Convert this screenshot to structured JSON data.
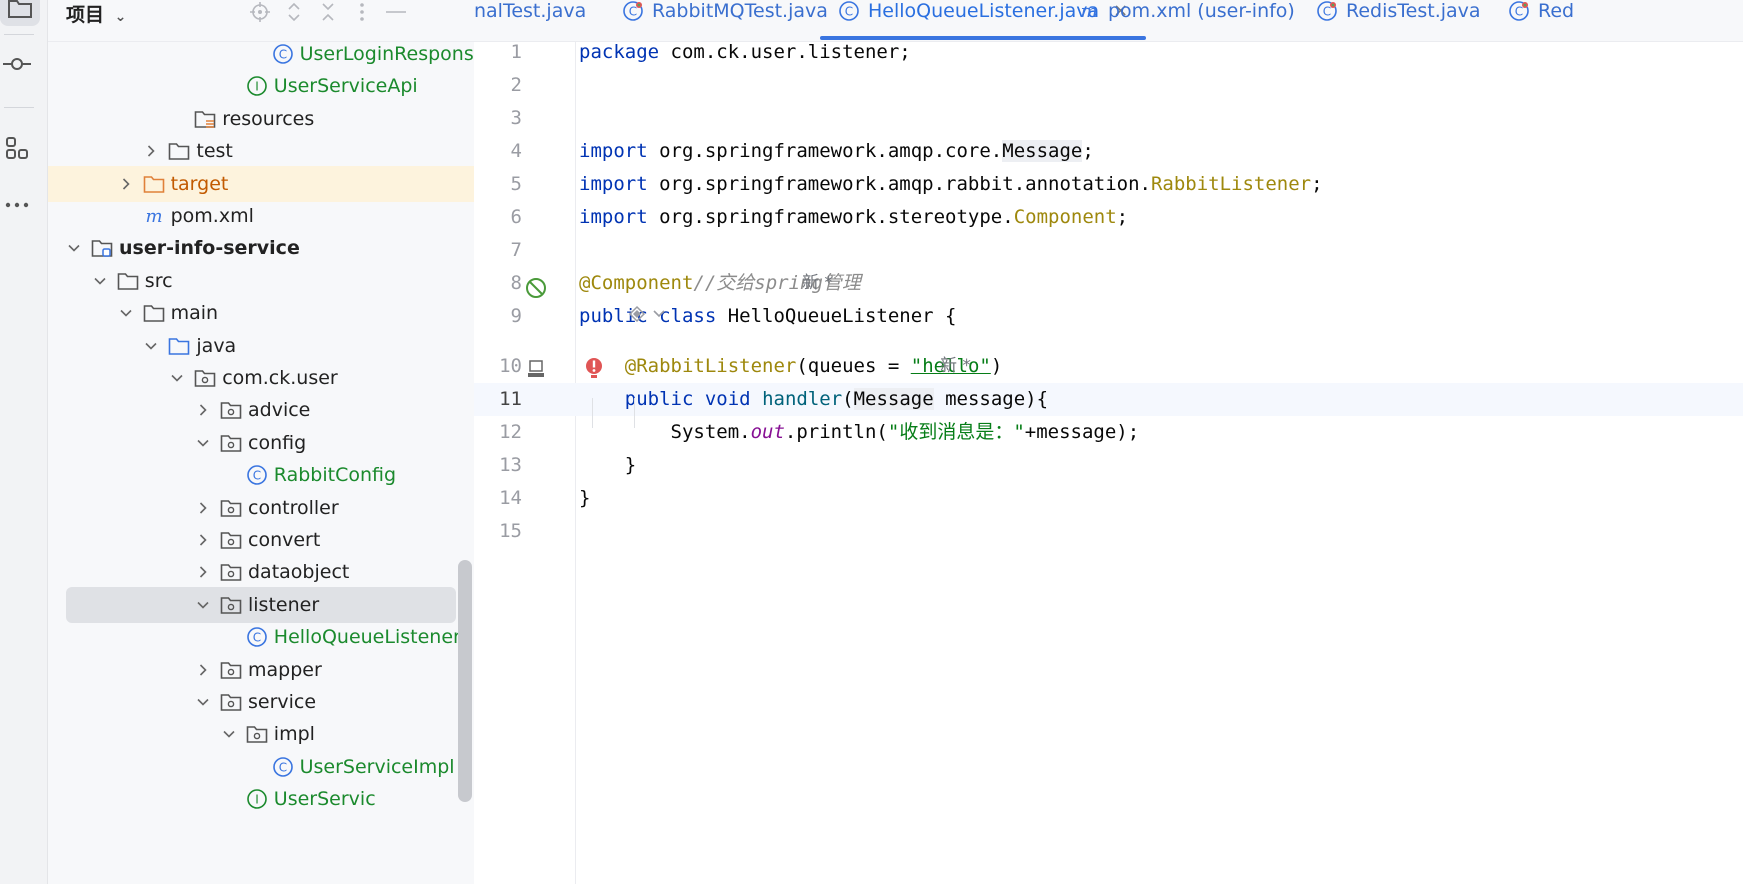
{
  "activity": {
    "items": [
      {
        "name": "project-icon"
      },
      {
        "name": "commit-icon"
      },
      {
        "name": "structure-icon"
      },
      {
        "name": "more-icon"
      }
    ]
  },
  "project_panel": {
    "title": "项目",
    "tree": [
      {
        "label": "UserLoginResponse",
        "icon": "class-icon",
        "level": 8,
        "style": "green"
      },
      {
        "label": "UserServiceApi",
        "icon": "interface-icon",
        "level": 7,
        "style": "green"
      },
      {
        "label": "resources",
        "icon": "resources-folder-icon",
        "level": 5
      },
      {
        "label": "test",
        "icon": "folder-icon",
        "level": 4,
        "chevron": "right"
      },
      {
        "label": "target",
        "icon": "folder-orange-icon",
        "level": 3,
        "chevron": "right",
        "style": "target"
      },
      {
        "label": "pom.xml",
        "icon": "maven-icon",
        "level": 3
      },
      {
        "label": "user-info-service",
        "icon": "module-icon",
        "level": 1,
        "chevron": "down",
        "style": "bold"
      },
      {
        "label": "src",
        "icon": "folder-icon",
        "level": 2,
        "chevron": "down"
      },
      {
        "label": "main",
        "icon": "folder-icon",
        "level": 3,
        "chevron": "down"
      },
      {
        "label": "java",
        "icon": "source-folder-icon",
        "level": 4,
        "chevron": "down"
      },
      {
        "label": "com.ck.user",
        "icon": "package-icon",
        "level": 5,
        "chevron": "down"
      },
      {
        "label": "advice",
        "icon": "package-icon",
        "level": 6,
        "chevron": "right"
      },
      {
        "label": "config",
        "icon": "package-icon",
        "level": 6,
        "chevron": "down"
      },
      {
        "label": "RabbitConfig",
        "icon": "class-icon",
        "level": 7,
        "style": "green"
      },
      {
        "label": "controller",
        "icon": "package-icon",
        "level": 6,
        "chevron": "right"
      },
      {
        "label": "convert",
        "icon": "package-icon",
        "level": 6,
        "chevron": "right"
      },
      {
        "label": "dataobject",
        "icon": "package-icon",
        "level": 6,
        "chevron": "right"
      },
      {
        "label": "listener",
        "icon": "package-icon",
        "level": 6,
        "chevron": "down",
        "style": "selected"
      },
      {
        "label": "HelloQueueListener",
        "icon": "class-icon",
        "level": 7,
        "style": "green"
      },
      {
        "label": "mapper",
        "icon": "package-icon",
        "level": 6,
        "chevron": "right"
      },
      {
        "label": "service",
        "icon": "package-icon",
        "level": 6,
        "chevron": "down"
      },
      {
        "label": "impl",
        "icon": "package-icon",
        "level": 7,
        "chevron": "down"
      },
      {
        "label": "UserServiceImpl",
        "icon": "class-icon",
        "level": 8,
        "style": "green"
      },
      {
        "label": "UserServic",
        "icon": "interface-icon",
        "level": 7,
        "style": "green"
      }
    ]
  },
  "tabs": [
    {
      "label": "nalTest.java",
      "icon": "",
      "active": false
    },
    {
      "label": "RabbitMQTest.java",
      "icon": "test-class-icon",
      "active": false
    },
    {
      "label": "HelloQueueListener.java",
      "icon": "class-icon",
      "active": true,
      "close": "×"
    },
    {
      "label": "pom.xml (user-info)",
      "icon": "maven-icon",
      "active": false
    },
    {
      "label": "RedisTest.java",
      "icon": "test-class-icon",
      "active": false
    },
    {
      "label": "Red",
      "icon": "test-class-icon",
      "active": false
    }
  ],
  "editor": {
    "current_line": 11,
    "lines": [
      {
        "n": "1",
        "tokens": [
          [
            "kw",
            "package"
          ],
          [
            "",
            " com.ck.user.listener;"
          ]
        ]
      },
      {
        "n": "2",
        "tokens": []
      },
      {
        "n": "3",
        "tokens": []
      },
      {
        "n": "4",
        "tokens": [
          [
            "kw",
            "import"
          ],
          [
            "",
            " org.springframework.amqp.core."
          ],
          [
            "msg",
            "Message"
          ],
          [
            "",
            ";"
          ]
        ]
      },
      {
        "n": "5",
        "tokens": [
          [
            "kw",
            "import"
          ],
          [
            "",
            " org.springframework.amqp.rabbit.annotation."
          ],
          [
            "cls",
            "RabbitListener"
          ],
          [
            "",
            ";"
          ]
        ]
      },
      {
        "n": "6",
        "tokens": [
          [
            "kw",
            "import"
          ],
          [
            "",
            " org.springframework.stereotype."
          ],
          [
            "cls",
            "Component"
          ],
          [
            "",
            ";"
          ]
        ]
      },
      {
        "n": "7",
        "tokens": []
      },
      {
        "n": "8",
        "tokens": [
          [
            "ann",
            "@Component"
          ],
          [
            "cmt",
            "//交给spring管理"
          ]
        ],
        "hint": "新 *"
      },
      {
        "n": "9",
        "tokens": [
          [
            "kw",
            "public class"
          ],
          [
            "",
            " HelloQueueListener {"
          ]
        ]
      },
      {
        "n": "10",
        "tokens": [
          [
            "",
            "    "
          ],
          [
            "ann",
            "@RabbitListener"
          ],
          [
            "",
            "(queues = "
          ],
          [
            "str",
            "\"hello\""
          ],
          [
            "",
            ")"
          ]
        ],
        "hint": "新 *"
      },
      {
        "n": "11",
        "tokens": [
          [
            "",
            "    "
          ],
          [
            "kw",
            "public void"
          ],
          [
            "",
            " "
          ],
          [
            "fn",
            "handler"
          ],
          [
            "",
            "("
          ],
          [
            "msg",
            "Message"
          ],
          [
            "",
            " message){"
          ]
        ]
      },
      {
        "n": "12",
        "tokens": [
          [
            "",
            "        System."
          ],
          [
            "fld",
            "out"
          ],
          [
            "",
            ".println("
          ],
          [
            "str",
            "\"收到消息是：\""
          ],
          [
            "",
            "+message);"
          ]
        ]
      },
      {
        "n": "13",
        "tokens": [
          [
            "",
            "    }"
          ]
        ]
      },
      {
        "n": "14",
        "tokens": [
          [
            "",
            "}"
          ]
        ]
      },
      {
        "n": "15",
        "tokens": []
      }
    ],
    "usage_hint_icon": "bean-usage-icon"
  },
  "colors": {
    "keyword": "#0033b3",
    "annotation": "#9e880d",
    "string": "#067d17",
    "active_tab": "#2a6fe0",
    "green_label": "#1b8a2d"
  }
}
